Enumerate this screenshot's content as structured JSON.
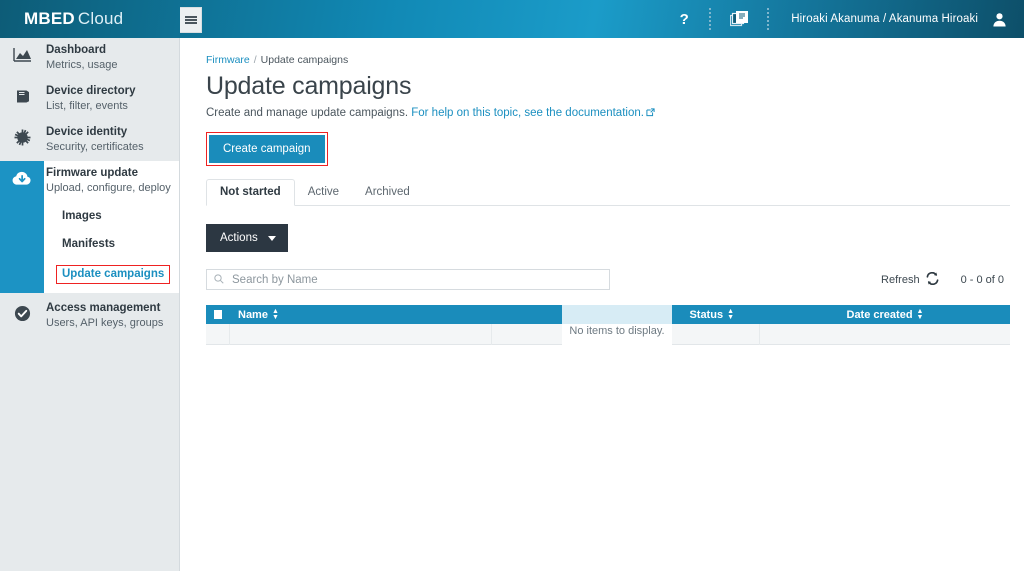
{
  "header": {
    "brand_bold": "MBED",
    "brand_light": "Cloud",
    "help_label": "?",
    "doc_icon_name": "documents-icon",
    "user_name": "Hiroaki Akanuma / Akanuma Hiroaki",
    "avatar_icon_name": "user-avatar-icon"
  },
  "sidebar": {
    "menu_icon_name": "hamburger-menu-icon",
    "items": [
      {
        "title": "Dashboard",
        "subtitle": "Metrics, usage",
        "icon": "chart-icon"
      },
      {
        "title": "Device directory",
        "subtitle": "List, filter, events",
        "icon": "book-icon"
      },
      {
        "title": "Device identity",
        "subtitle": "Security, certificates",
        "icon": "gear-icon"
      },
      {
        "title": "Firmware update",
        "subtitle": "Upload, configure, deploy",
        "icon": "cloud-download-icon"
      },
      {
        "title": "Access management",
        "subtitle": "Users, API keys, groups",
        "icon": "check-circle-icon"
      }
    ],
    "sub_items": [
      {
        "label": "Images",
        "selected": false
      },
      {
        "label": "Manifests",
        "selected": false
      },
      {
        "label": "Update campaigns",
        "selected": true
      }
    ]
  },
  "main": {
    "breadcrumb": {
      "root": "Firmware",
      "separator": "/",
      "current": "Update campaigns"
    },
    "title": "Update campaigns",
    "description_text": "Create and manage update campaigns.",
    "description_link": "For help on this topic, see the documentation.",
    "external_link_icon": "external-link-icon",
    "create_button": "Create campaign",
    "tabs": [
      {
        "label": "Not started",
        "active": true
      },
      {
        "label": "Active",
        "active": false
      },
      {
        "label": "Archived",
        "active": false
      }
    ],
    "actions_button": "Actions",
    "search": {
      "placeholder": "Search by Name",
      "value": "",
      "icon": "search-icon"
    },
    "refresh": {
      "label": "Refresh",
      "icon": "refresh-icon"
    },
    "pagination_count": "0 - 0 of 0",
    "table": {
      "columns": [
        {
          "label": "",
          "name": "select-all-checkbox"
        },
        {
          "label": "Name",
          "name": "column-name"
        },
        {
          "label": "Status",
          "name": "column-status"
        },
        {
          "label": "Date created",
          "name": "column-date-created"
        }
      ],
      "rows": [],
      "empty_message": "No items to display."
    }
  },
  "colors": {
    "brand_blue": "#1a8cbb",
    "header_dark": "#0d5c77",
    "sidebar_bg": "#e6eaec",
    "dark_button": "#2c3742",
    "highlight_red": "#ee2222",
    "link_blue": "#1b8fc0"
  }
}
